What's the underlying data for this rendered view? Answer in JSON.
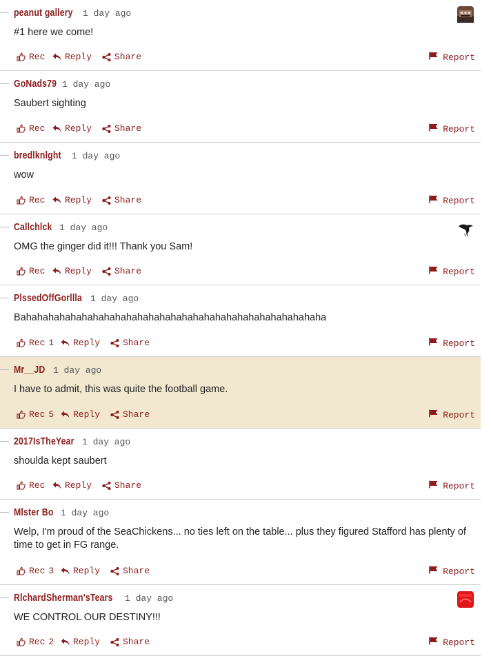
{
  "labels": {
    "rec": "Rec",
    "reply": "Reply",
    "share": "Share",
    "report": "Report"
  },
  "colors": {
    "accent": "#8c1c1c",
    "highlight_bg": "#f1e8cf",
    "divider": "#cfcfcf"
  },
  "comments": [
    {
      "author": "peanut gallery",
      "time": "1 day ago",
      "text": "#1 here we come!",
      "rec_count": "",
      "avatar": "building-avatar"
    },
    {
      "author": "GoNads79",
      "time": "1 day ago",
      "text": "Saubert sighting",
      "rec_count": "",
      "avatar": ""
    },
    {
      "author": "bredlknlght",
      "time": "1 day ago",
      "text": "wow",
      "rec_count": "",
      "avatar": ""
    },
    {
      "author": "Callchlck",
      "time": "1 day ago",
      "text": "OMG the ginger did it!!! Thank you Sam!",
      "rec_count": "",
      "avatar": "bird-avatar"
    },
    {
      "author": "PlssedOffGorllla",
      "time": "1 day ago",
      "text": "Bahahahahahahahahahahahahahahahahahahahahahahahahahahaha",
      "rec_count": "1",
      "avatar": ""
    },
    {
      "author": "Mr__JD",
      "time": "1 day ago",
      "text": "I have to admit, this was quite the football game.",
      "rec_count": "5",
      "avatar": "",
      "highlight": true
    },
    {
      "author": "2017IsTheYear",
      "time": "1 day ago",
      "text": "shoulda kept saubert",
      "rec_count": "",
      "avatar": ""
    },
    {
      "author": "Mlster Bo",
      "time": "1 day ago",
      "text": "Welp, I'm proud of the SeaChickens... no ties left on the table... plus they figured Stafford has plenty of time to get in FG range.",
      "rec_count": "3",
      "avatar": ""
    },
    {
      "author": "RlchardSherman'sTears",
      "time": "1 day ago",
      "text": "WE CONTROL OUR DESTINY!!!",
      "rec_count": "2",
      "avatar": "red-avatar"
    }
  ]
}
